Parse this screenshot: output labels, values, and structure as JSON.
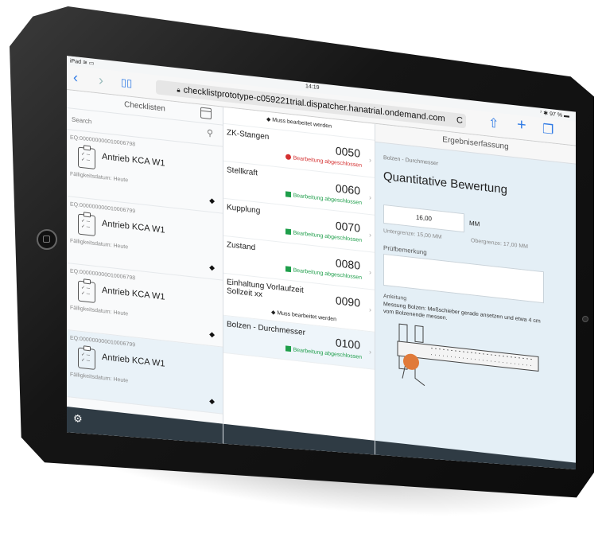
{
  "status_bar": {
    "device": "iPad ≋ ▭",
    "time": "14:19",
    "battery": "⁷ ✱ 97 % ▬"
  },
  "safari": {
    "back_icon": "chevron-left-icon",
    "forward_icon": "chevron-right-icon",
    "bookmarks_icon": "book-icon",
    "url": "checklistprototype-c059221trial.dispatcher.hanatrial.ondemand.com",
    "reload_icon": "C",
    "share_icon": "share-icon",
    "add_icon": "plus-icon",
    "tabs_icon": "tabs-icon"
  },
  "checklists": {
    "title": "Checklisten",
    "search_placeholder": "Search",
    "items": [
      {
        "id": "EQ:000000000010006798",
        "title": "Antrieb KCA W1",
        "due": "Fälligkeitsdatum: Heute"
      },
      {
        "id": "EQ:000000000010006799",
        "title": "Antrieb KCA W1",
        "due": "Fälligkeitsdatum: Heute"
      },
      {
        "id": "EQ:000000000010006798",
        "title": "Antrieb KCA W1",
        "due": "Fälligkeitsdatum: Heute"
      },
      {
        "id": "EQ:000000000010006799",
        "title": "Antrieb KCA W1",
        "due": "Fälligkeitsdatum: Heute"
      }
    ]
  },
  "operations": {
    "top_note": "◆ Muss bearbeitet werden",
    "items": [
      {
        "name": "ZK-Stangen",
        "number": "0050",
        "status": "Bearbeitung abgeschlossen"
      },
      {
        "name": "Stellkraft",
        "number": "0060",
        "status": "Bearbeitung abgeschlossen"
      },
      {
        "name": "Kupplung",
        "number": "0070",
        "status": "Bearbeitung abgeschlossen"
      },
      {
        "name": "Zustand",
        "number": "0080",
        "status": "Bearbeitung abgeschlossen"
      },
      {
        "name": "Einhaltung Vorlaufzeit Sollzeit xx",
        "number": "0090",
        "must": "◆ Muss bearbeitet werden"
      },
      {
        "name": "Bolzen - Durchmesser",
        "number": "0100",
        "status": "Bearbeitung abgeschlossen"
      }
    ]
  },
  "result": {
    "header": "Ergebniserfassung",
    "breadcrumb": "Bolzen - Durchmesser",
    "title": "Quantitative Bewertung",
    "value": "16,00",
    "unit": "MM",
    "lower_limit": "Untergrenze: 15,00 MM",
    "upper_limit": "Obergrenze: 17,00 MM",
    "remark_label": "Prüfbemerkung",
    "instruction_label": "Anleitung",
    "instruction_text": "Messung Bolzen: Meßschieber gerade ansetzen und etwa 4 cm vom Bolzenende messen."
  },
  "colors": {
    "accent": "#2f7ae5",
    "success": "#1e9e4a",
    "error": "#d43030",
    "footer": "#2f3b44",
    "ball": "#e07a3a"
  }
}
